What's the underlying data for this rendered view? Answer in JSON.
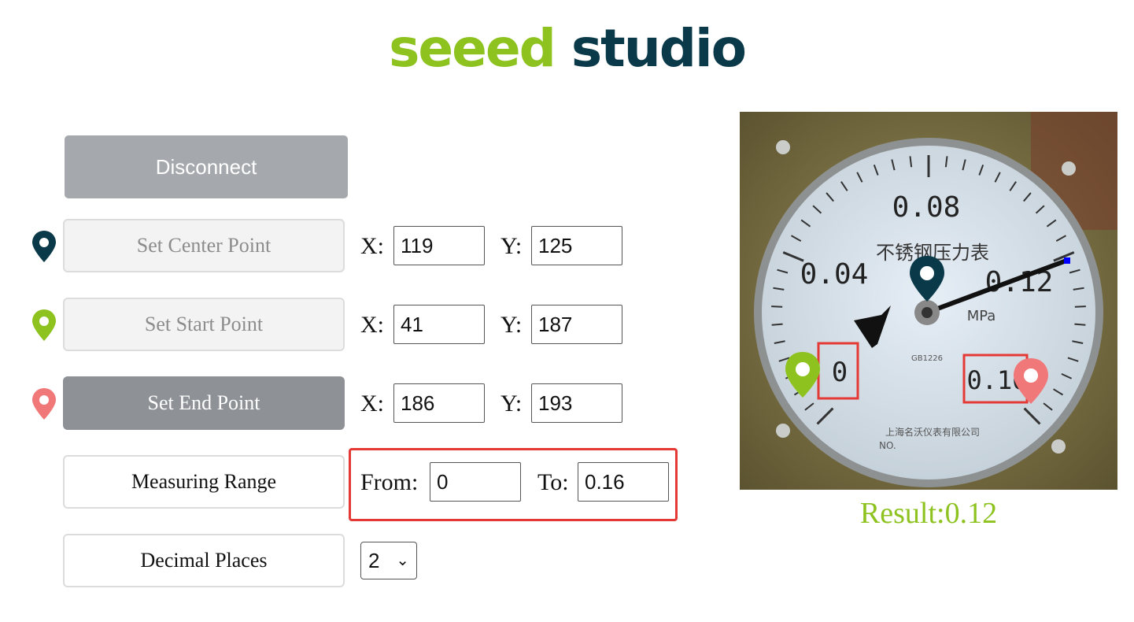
{
  "logo": {
    "part1": "seeed",
    "part2": "studio"
  },
  "buttons": {
    "disconnect": "Disconnect",
    "set_center": "Set Center Point",
    "set_start": "Set Start Point",
    "set_end": "Set End Point",
    "measuring_range": "Measuring Range",
    "decimal_places": "Decimal Places"
  },
  "labels": {
    "x": "X:",
    "y": "Y:",
    "from": "From:",
    "to": "To:"
  },
  "center": {
    "x": "119",
    "y": "125"
  },
  "start": {
    "x": "41",
    "y": "187"
  },
  "end": {
    "x": "186",
    "y": "193"
  },
  "range": {
    "from": "0",
    "to": "0.16"
  },
  "decimal": {
    "selected": "2",
    "chevron": "⌄"
  },
  "gauge_image": {
    "scale_labels": [
      "0",
      "0.04",
      "0.08",
      "0.12",
      "0.16"
    ],
    "unit": "MPa",
    "face_text": "不锈钢压力表",
    "maker_text": "上海名沃仪表有限公司",
    "serial_text": "NO.",
    "small_text": "GB1226"
  },
  "result": "Result:0.12",
  "colors": {
    "center_pin": "#0a3a4a",
    "start_pin": "#8dc21f",
    "end_pin": "#f07878",
    "accent": "#8dc21f",
    "highlight": "#e53935"
  }
}
